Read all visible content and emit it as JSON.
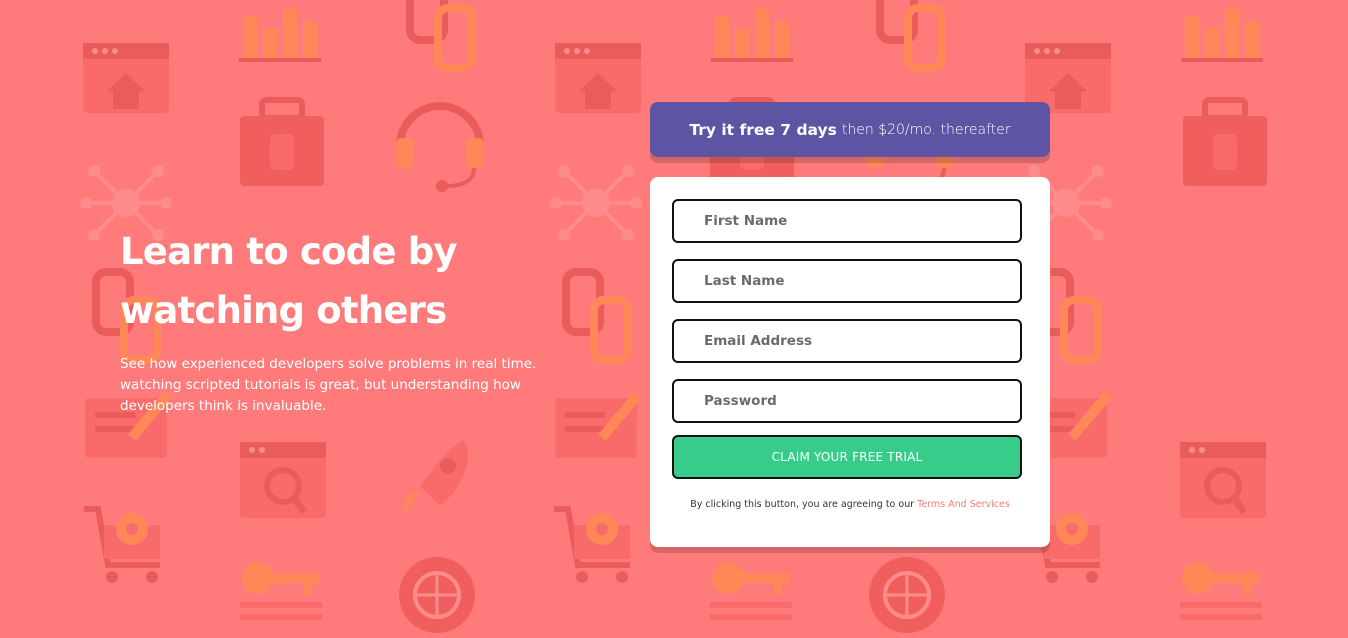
{
  "theme": {
    "background": "#ff7a7a",
    "promo": "#5e54a4",
    "accent": "#38cc8b",
    "link": "#ff7a7a"
  },
  "background_pattern": {
    "icons": [
      "browser-home-icon",
      "bar-chart-icon",
      "toolbox-icon",
      "headset-icon",
      "network-icon",
      "chain-link-icon",
      "document-pencil-icon",
      "rocket-icon",
      "browser-magnifier-icon",
      "cart-gear-icon",
      "globe-gear-icon",
      "key-icon"
    ]
  },
  "hero": {
    "title_line1": "Learn to code by",
    "title_line2": "watching others",
    "description": "See how experienced developers solve problems in real time. watching scripted tutorials is great, but understanding how developers think is invaluable."
  },
  "promo": {
    "bold": "Try it free 7 days",
    "rest": "then $20/mo. thereafter"
  },
  "form": {
    "first_name_placeholder": "First Name",
    "last_name_placeholder": "Last Name",
    "email_placeholder": "Email Address",
    "password_placeholder": "Password",
    "submit_label": "CLAIM YOUR FREE TRIAL",
    "terms_prefix": "By clicking this button, you are agreeing to our",
    "terms_link": "Terms And Services"
  }
}
